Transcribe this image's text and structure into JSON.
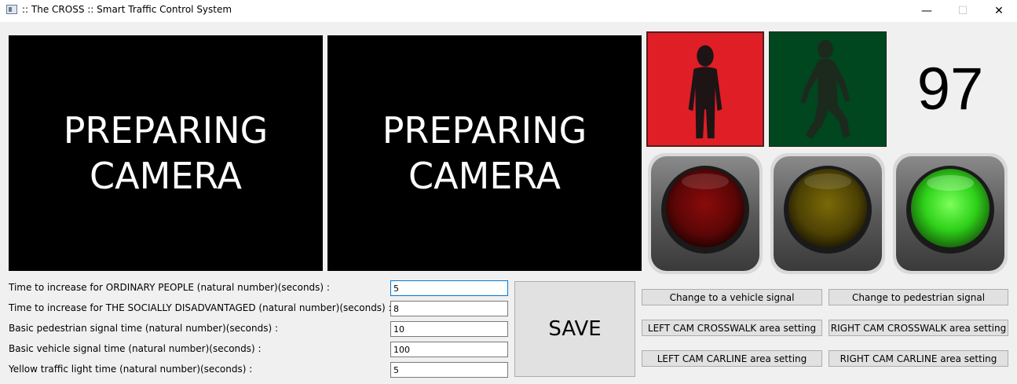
{
  "window": {
    "title": ":: The CROSS :: Smart Traffic Control System",
    "minimize": "—",
    "maximize": "☐",
    "close": "✕"
  },
  "cameras": {
    "left": "PREPARING\nCAMERA",
    "right": "PREPARING\nCAMERA"
  },
  "signals": {
    "pedestrian_stop_color": "#e01e26",
    "pedestrian_walk_color": "#00461f",
    "countdown": "97",
    "lights": [
      "red-off",
      "yellow-off",
      "green-on"
    ]
  },
  "settings": {
    "rows": [
      {
        "label": "Time to increase for ORDINARY PEOPLE (natural number)(seconds) :",
        "value": "5"
      },
      {
        "label": "Time to increase for THE SOCIALLY DISADVANTAGED (natural number)(seconds) :",
        "value": "8"
      },
      {
        "label": "Basic pedestrian signal time (natural number)(seconds) :",
        "value": "10"
      },
      {
        "label": "Basic vehicle signal time (natural number)(seconds) :",
        "value": "100"
      },
      {
        "label": "Yellow traffic light time (natural number)(seconds) :",
        "value": "5"
      }
    ],
    "save_label": "SAVE"
  },
  "buttons": {
    "vehicle_signal": "Change to a vehicle signal",
    "pedestrian_signal": "Change to pedestrian signal",
    "left_crosswalk": "LEFT CAM CROSSWALK area setting",
    "right_crosswalk": "RIGHT CAM CROSSWALK area setting",
    "left_carline": "LEFT CAM CARLINE area setting",
    "right_carline": "RIGHT CAM CARLINE area setting"
  }
}
